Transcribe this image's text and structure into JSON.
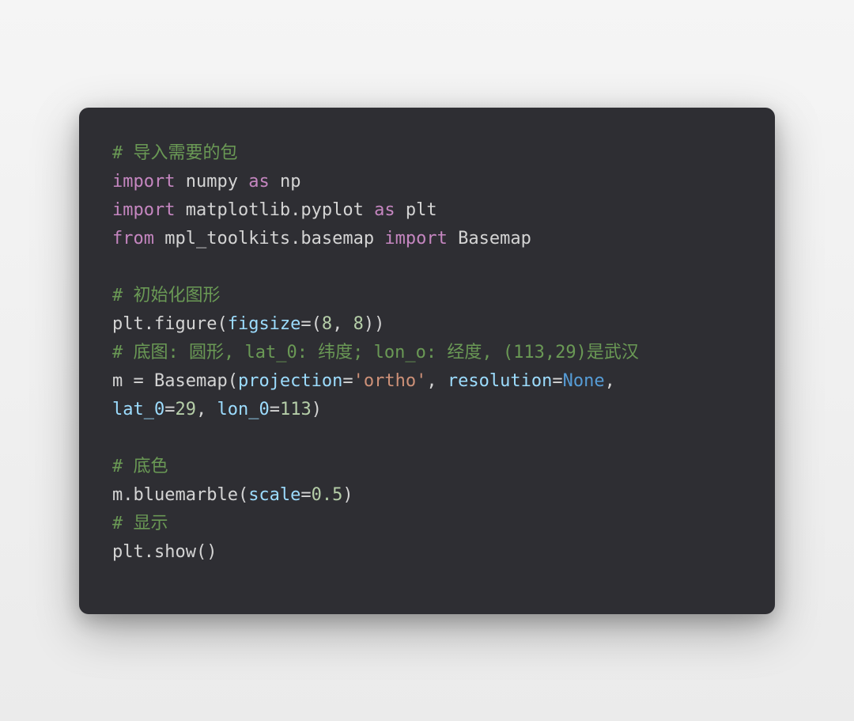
{
  "code": {
    "lines": [
      [
        {
          "cls": "comment",
          "text": "# 导入需要的包"
        }
      ],
      [
        {
          "cls": "keyword",
          "text": "import"
        },
        {
          "cls": "plain",
          "text": " numpy "
        },
        {
          "cls": "keyword",
          "text": "as"
        },
        {
          "cls": "plain",
          "text": " np"
        }
      ],
      [
        {
          "cls": "keyword",
          "text": "import"
        },
        {
          "cls": "plain",
          "text": " matplotlib.pyplot "
        },
        {
          "cls": "keyword",
          "text": "as"
        },
        {
          "cls": "plain",
          "text": " plt"
        }
      ],
      [
        {
          "cls": "keyword",
          "text": "from"
        },
        {
          "cls": "plain",
          "text": " mpl_toolkits.basemap "
        },
        {
          "cls": "keyword",
          "text": "import"
        },
        {
          "cls": "plain",
          "text": " Basemap"
        }
      ],
      [
        {
          "cls": "plain",
          "text": ""
        }
      ],
      [
        {
          "cls": "comment",
          "text": "# 初始化图形"
        }
      ],
      [
        {
          "cls": "plain",
          "text": "plt.figure("
        },
        {
          "cls": "param",
          "text": "figsize"
        },
        {
          "cls": "plain",
          "text": "=("
        },
        {
          "cls": "num",
          "text": "8"
        },
        {
          "cls": "plain",
          "text": ", "
        },
        {
          "cls": "num",
          "text": "8"
        },
        {
          "cls": "plain",
          "text": "))"
        }
      ],
      [
        {
          "cls": "comment",
          "text": "# 底图: 圆形, lat_0: 纬度; lon_o: 经度, (113,29)是武汉"
        }
      ],
      [
        {
          "cls": "plain",
          "text": "m = Basemap("
        },
        {
          "cls": "param",
          "text": "projection"
        },
        {
          "cls": "plain",
          "text": "="
        },
        {
          "cls": "string",
          "text": "'ortho'"
        },
        {
          "cls": "plain",
          "text": ", "
        },
        {
          "cls": "param",
          "text": "resolution"
        },
        {
          "cls": "plain",
          "text": "="
        },
        {
          "cls": "none",
          "text": "None"
        },
        {
          "cls": "plain",
          "text": ", "
        }
      ],
      [
        {
          "cls": "param",
          "text": "lat_0"
        },
        {
          "cls": "plain",
          "text": "="
        },
        {
          "cls": "num",
          "text": "29"
        },
        {
          "cls": "plain",
          "text": ", "
        },
        {
          "cls": "param",
          "text": "lon_0"
        },
        {
          "cls": "plain",
          "text": "="
        },
        {
          "cls": "num",
          "text": "113"
        },
        {
          "cls": "plain",
          "text": ")"
        }
      ],
      [
        {
          "cls": "plain",
          "text": ""
        }
      ],
      [
        {
          "cls": "comment",
          "text": "# 底色"
        }
      ],
      [
        {
          "cls": "plain",
          "text": "m.bluemarble("
        },
        {
          "cls": "param",
          "text": "scale"
        },
        {
          "cls": "plain",
          "text": "="
        },
        {
          "cls": "num",
          "text": "0.5"
        },
        {
          "cls": "plain",
          "text": ")"
        }
      ],
      [
        {
          "cls": "comment",
          "text": "# 显示"
        }
      ],
      [
        {
          "cls": "plain",
          "text": "plt.show()"
        }
      ]
    ]
  }
}
